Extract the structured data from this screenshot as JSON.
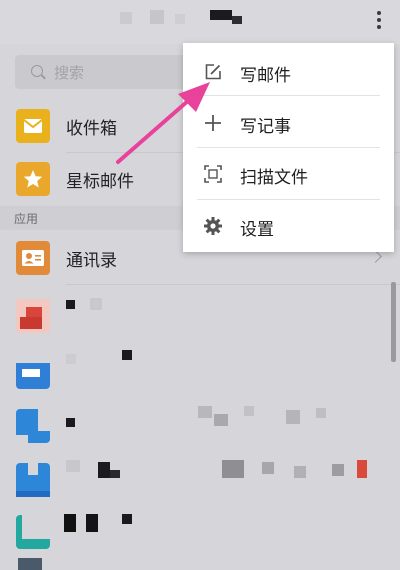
{
  "search": {
    "placeholder": "搜索"
  },
  "mailboxes": [
    {
      "label": "收件箱",
      "icon": "mail-icon",
      "color": "#e9b11c"
    },
    {
      "label": "星标邮件",
      "icon": "star-icon",
      "color": "#e9a82c"
    }
  ],
  "apps_section": {
    "label": "应用"
  },
  "apps": [
    {
      "label": "通讯录",
      "icon": "contacts-icon",
      "color": "#e08a3a"
    }
  ],
  "menu": {
    "items": [
      {
        "label": "写邮件",
        "icon": "compose-icon"
      },
      {
        "label": "写记事",
        "icon": "plus-icon"
      },
      {
        "label": "扫描文件",
        "icon": "scan-icon"
      },
      {
        "label": "设置",
        "icon": "gear-icon"
      }
    ]
  },
  "colors": {
    "accent_arrow": "#e8429b",
    "mail_yellow": "#e9b11c",
    "contacts_orange": "#e08a3a"
  }
}
